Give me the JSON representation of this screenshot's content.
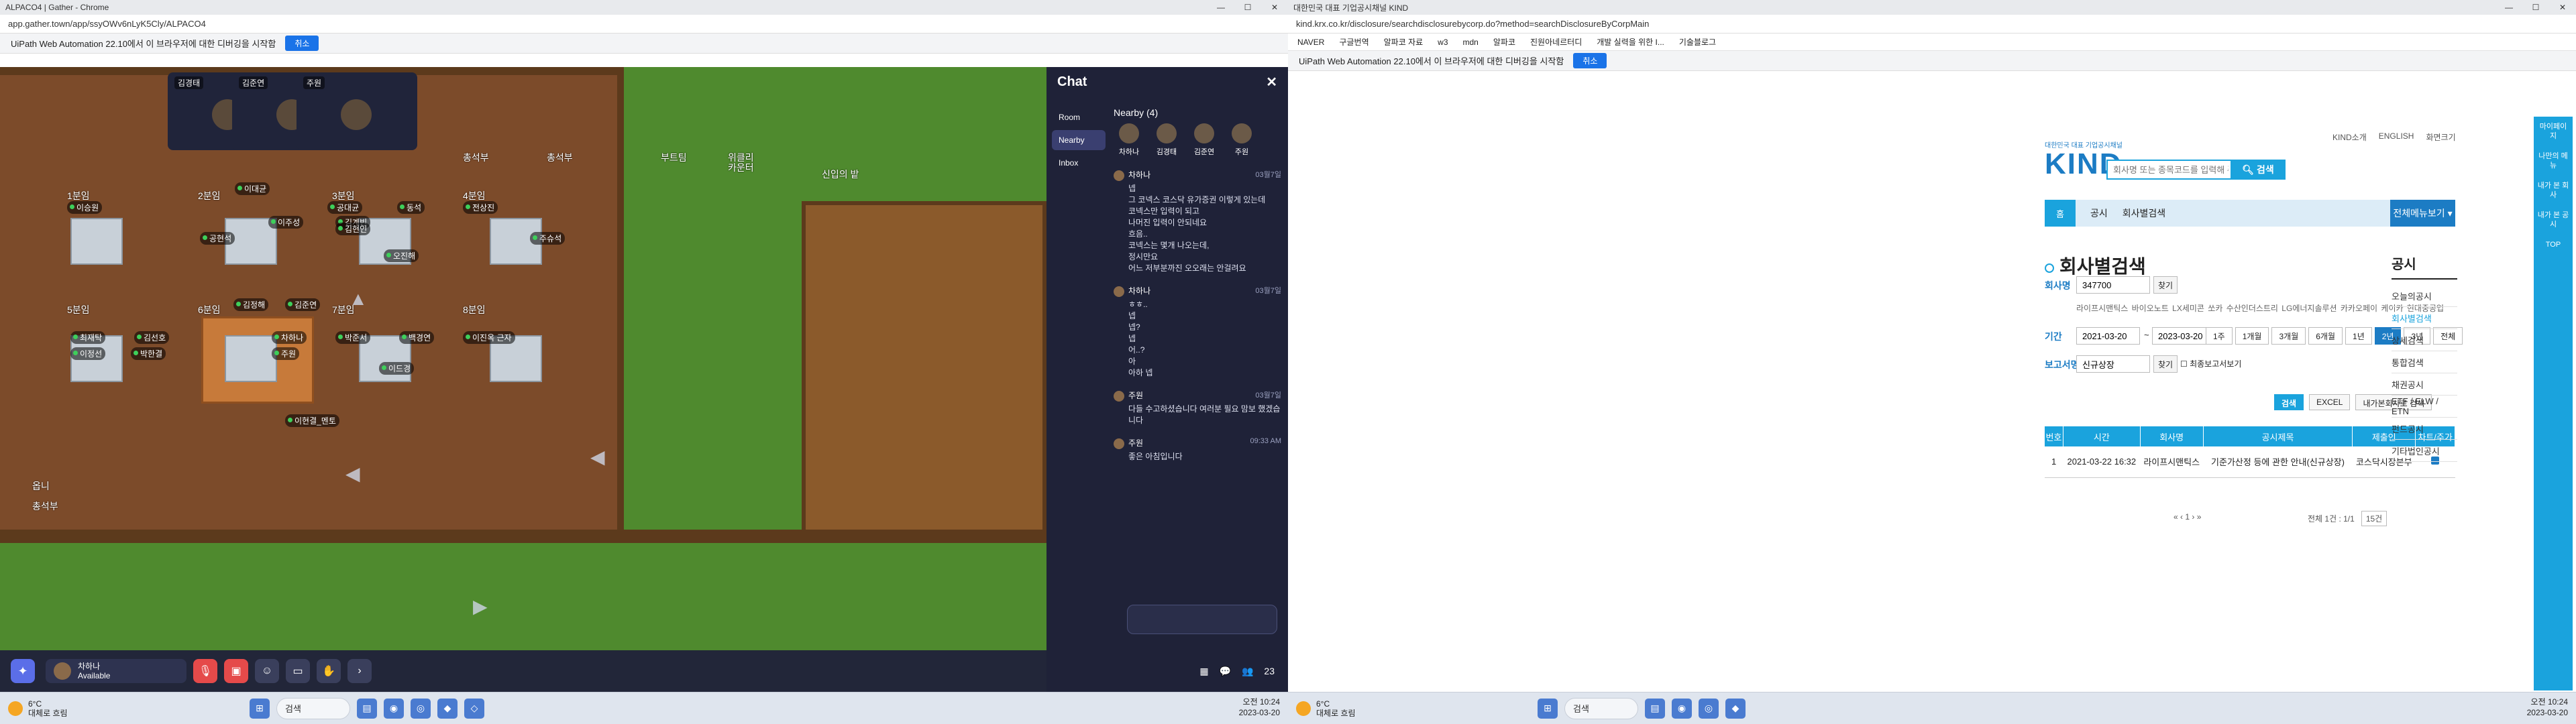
{
  "left": {
    "window_title": "ALPACO4 | Gather - Chrome",
    "url": "app.gather.town/app/ssyOWv6nLyK5Cly/ALPACO4",
    "infobar": {
      "text": "UiPath Web Automation 22.10에서 이 브라우저에 대한 디버깅을 시작함",
      "cancel": "취소"
    },
    "map": {
      "rooms": [
        "1분임",
        "2분임",
        "3분임",
        "4분임",
        "5분임",
        "6분임",
        "7분임",
        "8분임"
      ],
      "labels": [
        "총석부",
        "총석부",
        "부트팀",
        "위클리",
        "카운터",
        "신입의 밭",
        "옵니",
        "총석부"
      ],
      "people": [
        "이승원",
        "이대균",
        "이주성",
        "김계빈",
        "공대균",
        "동석",
        "전상진",
        "공현석",
        "김현인",
        "오진해",
        "주슈석",
        "김정해",
        "김준연",
        "최재탁",
        "김선호",
        "차하나",
        "주원",
        "박준서",
        "백경연",
        "이진옥 근자",
        "이정선",
        "박한결",
        "이드경",
        "이현결_멘토"
      ]
    },
    "videos": [
      {
        "name": "김경태"
      },
      {
        "name": "김준연"
      },
      {
        "name": "주원"
      }
    ],
    "chat": {
      "title": "Chat",
      "nav": [
        "Room",
        "Nearby",
        "Inbox"
      ],
      "nearby_title": "Nearby (4)",
      "nearby": [
        "차하나",
        "김경태",
        "김준연",
        "주원"
      ],
      "messages": [
        {
          "from": "차하나",
          "time": "03월7일",
          "lines": [
            "넵",
            "그 코넥스 코스닥 유가증권 이렇게 있는데",
            "코넥스만 입력이 되고",
            "나머진 입력이 안되네요",
            "흐음..",
            "코넥스는 몇개 나오는데,",
            "정시만요",
            "어느 저부분까진 오오래는 안걸려요"
          ]
        },
        {
          "from": "차하나",
          "time": "03월7일",
          "lines": [
            "ㅎㅎ..",
            "넵",
            "넵?",
            "넵",
            "어..?",
            "아",
            "아하 넵"
          ]
        },
        {
          "from": "주원",
          "time": "03월7일",
          "lines": [
            "다들 수고하셨습니다 여러분 필요 맘보 했겠습니다"
          ]
        },
        {
          "from": "주원",
          "time": "09:33 AM",
          "lines": [
            "좋은 아침입니다"
          ]
        }
      ]
    },
    "toolbar": {
      "user": "차하나",
      "status": "Available",
      "count": "23"
    },
    "taskbar": {
      "temp": "6°C",
      "weather": "대체로 흐림",
      "search": "검색",
      "time": "오전 10:24",
      "date": "2023-03-20"
    }
  },
  "right": {
    "tab_title": "대한민국 대표 기업공시채널 KIND",
    "url": "kind.krx.co.kr/disclosure/searchdisclosurebycorp.do?method=searchDisclosureByCorpMain",
    "bookmarks": [
      "NAVER",
      "구글번역",
      "알파코 자료",
      "w3",
      "mdn",
      "알파코",
      "진원아네르터디",
      "개발 실력을 위한 I...",
      "기술블로그"
    ],
    "infobar": {
      "text": "UiPath Web Automation 22.10에서 이 브라우저에 대한 디버깅을 시작함",
      "cancel": "취소"
    },
    "topnav": [
      "KIND소개",
      "ENGLISH",
      "화면크기"
    ],
    "logo_sub": "대한민국 대표 기업공시채널",
    "logo": "KIND",
    "search_placeholder": "회사명 또는 종목코드를 입력해 주세요",
    "search_btn": "검색",
    "breadcrumb": [
      "홈",
      "공시",
      "회사별검색"
    ],
    "allmenu": "전체메뉴보기",
    "page_title": "회사별검색",
    "form": {
      "company_label": "회사명",
      "company_value": "347700",
      "find": "찾기",
      "suggest": "라이프시맨틱스 바이오노트 LX세미콘 쏘카 수산인더스트리 LG에너지솔루션 카카오페이 케이카 현대중공업",
      "period_label": "기간",
      "from": "2021-03-20",
      "to": "2023-03-20",
      "periods": [
        "1주",
        "1개월",
        "3개월",
        "6개월",
        "1년",
        "2년",
        "3년",
        "전체"
      ],
      "active_period": "2년",
      "report_label": "보고서명",
      "report_value": "신규상장",
      "final_only": "최종보고서보기"
    },
    "actions": [
      "검색",
      "EXCEL",
      "내가본회사로 검색"
    ],
    "table": {
      "headers": [
        "번호",
        "시간",
        "회사명",
        "공시제목",
        "제출인",
        "차트/주가"
      ],
      "rows": [
        {
          "no": "1",
          "time": "2021-03-22 16:32",
          "company": "라이프시맨틱스",
          "title": "기준가산정 등에 관한 안내(신규상장)",
          "submitter": "코스닥시장본부"
        }
      ]
    },
    "pager": {
      "page": "1",
      "total": "전체 1건 : 1/1",
      "per_page": "15건"
    },
    "side": {
      "title": "공시",
      "items": [
        "오늘의공시",
        "회사별검색",
        "상세검색",
        "통합검색",
        "채권공시",
        "ETF / ELW / ETN",
        "펀드공시",
        "기타법인공시"
      ],
      "active": "회사별검색"
    },
    "rail": [
      "마이페이지",
      "나만의 메뉴",
      "내가 본 회사",
      "내가 본 공시",
      "TOP"
    ],
    "taskbar": {
      "temp": "6°C",
      "weather": "대체로 흐림",
      "search": "검색",
      "time": "오전 10:24",
      "date": "2023-03-20"
    }
  }
}
